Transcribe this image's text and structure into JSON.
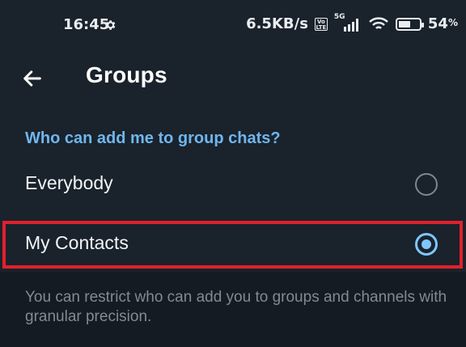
{
  "status_bar": {
    "time": "16:45",
    "network_speed": "6.5KB/s",
    "volte_badge": "Vo LTE",
    "network_type": "5G",
    "battery_percent": "54",
    "battery_percent_symbol": "%",
    "icons": [
      "gear-icon",
      "volte-icon",
      "signal-icon",
      "wifi-icon",
      "battery-icon"
    ]
  },
  "app_bar": {
    "title": "Groups",
    "back_icon": "arrow-left-icon"
  },
  "privacy": {
    "section_title": "Who can add me to group chats?",
    "options": [
      {
        "label": "Everybody",
        "selected": false
      },
      {
        "label": "My Contacts",
        "selected": true
      }
    ],
    "footer_note": "You can restrict who can add you to groups and channels with granular precision."
  },
  "colors": {
    "background": "#151b22",
    "surface": "#1a222b",
    "accent": "#6fb6ee",
    "radio_active": "#7fc6ff",
    "highlight": "#e2202c"
  }
}
